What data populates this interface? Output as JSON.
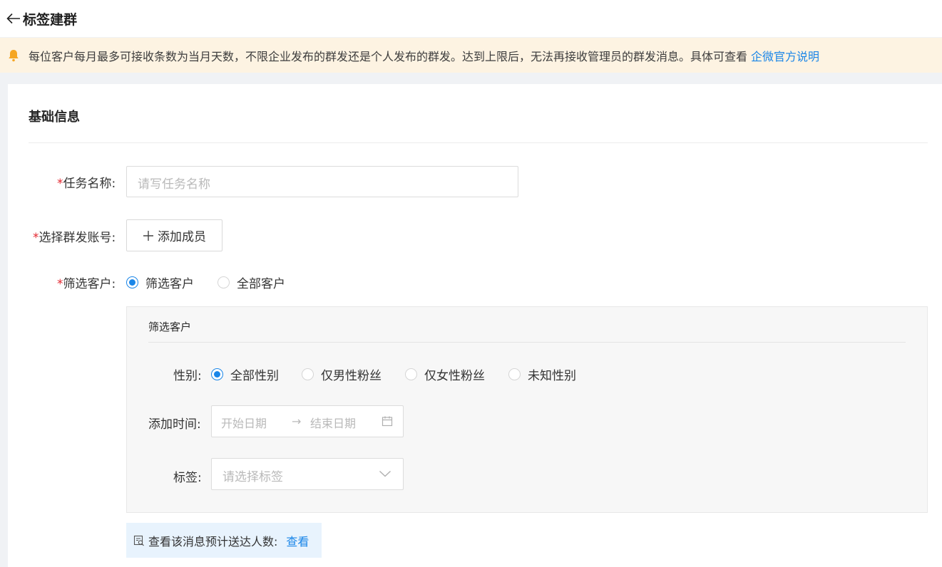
{
  "header": {
    "title": "标签建群"
  },
  "notice": {
    "text": "每位客户每月最多可接收条数为当月天数，不限企业发布的群发还是个人发布的群发。达到上限后，无法再接收管理员的群发消息。具体可查看",
    "link": "企微官方说明"
  },
  "section": {
    "title": "基础信息"
  },
  "form": {
    "task_name": {
      "label": "任务名称:",
      "placeholder": "请写任务名称"
    },
    "account": {
      "label": "选择群发账号:",
      "button": "添加成员"
    },
    "filter_customer": {
      "label": "筛选客户:",
      "options": [
        "筛选客户",
        "全部客户"
      ],
      "selected": "筛选客户"
    }
  },
  "filter_box": {
    "title": "筛选客户",
    "gender": {
      "label": "性别:",
      "options": [
        "全部性别",
        "仅男性粉丝",
        "仅女性粉丝",
        "未知性别"
      ],
      "selected": "全部性别"
    },
    "add_time": {
      "label": "添加时间:",
      "start_placeholder": "开始日期",
      "end_placeholder": "结束日期"
    },
    "tags": {
      "label": "标签:",
      "placeholder": "请选择标签"
    }
  },
  "preview": {
    "text": "查看该消息预计送达人数:",
    "link": "查看"
  },
  "colors": {
    "accent": "#1a86e8",
    "required": "#e3262f",
    "notice_bg": "#fdf3e2",
    "bell": "#f5a623"
  },
  "icons": [
    "back-arrow-icon",
    "bell-icon",
    "plus-icon",
    "calendar-icon",
    "chevron-down-icon",
    "search-doc-icon"
  ]
}
